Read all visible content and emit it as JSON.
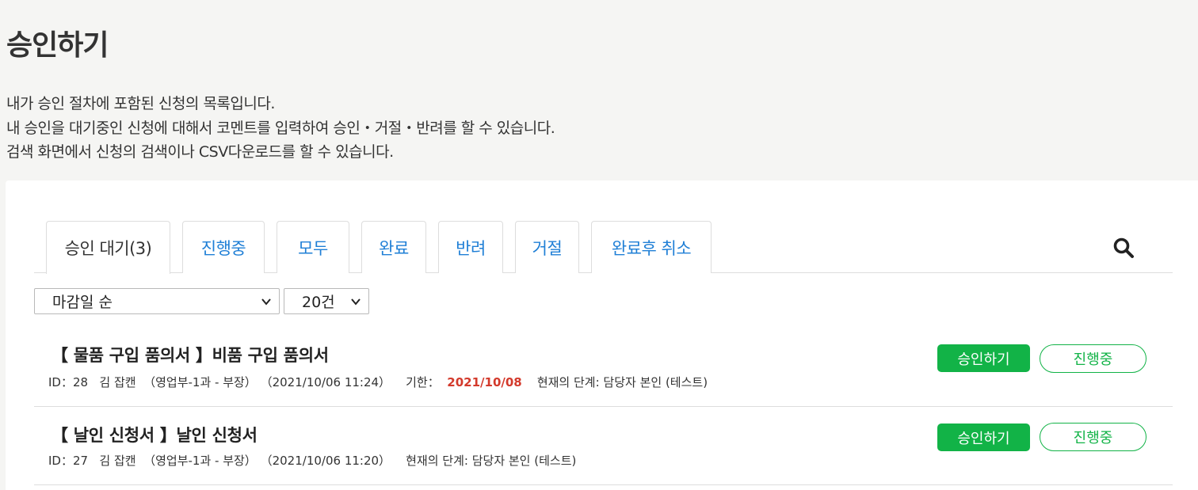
{
  "page": {
    "title": "승인하기",
    "description": [
      "내가 승인 절차에 포함된 신청의 목록입니다.",
      "내 승인을 대기중인 신청에 대해서 코멘트를 입력하여 승인・거절・반려를 할 수 있습니다.",
      "검색 화면에서 신청의 검색이나 CSV다운로드를 할 수 있습니다."
    ]
  },
  "tabs": [
    {
      "label": "승인 대기(3)",
      "active": true
    },
    {
      "label": "진행중",
      "active": false
    },
    {
      "label": "모두",
      "active": false
    },
    {
      "label": "완료",
      "active": false
    },
    {
      "label": "반려",
      "active": false
    },
    {
      "label": "거절",
      "active": false
    },
    {
      "label": "완료후 취소",
      "active": false
    }
  ],
  "icons": {
    "search": "search-icon",
    "dropdown": "chevron-down-icon"
  },
  "filters": {
    "sort": {
      "selected": "마감일 순"
    },
    "count": {
      "selected": "20건"
    }
  },
  "colors": {
    "accent_green": "#12b347",
    "tab_link": "#1f7fd6",
    "deadline_red": "#d33a2c"
  },
  "items": [
    {
      "title": "【 물품 구입 품의서 】비품 구입 품의서",
      "id": "ID：28",
      "applicant": "김 잡캔",
      "dept": "（영업부-1과 - 부장）",
      "datetime": "（2021/10/06 11:24）",
      "deadline_label": "기한：",
      "deadline": "2021/10/08",
      "stage": "현재의 단계: 담당자 본인 (테스트)",
      "approve_label": "승인하기",
      "status_label": "진행중"
    },
    {
      "title": "【 날인 신청서 】날인 신청서",
      "id": "ID：27",
      "applicant": "김 잡캔",
      "dept": "（영업부-1과 - 부장）",
      "datetime": "（2021/10/06 11:20）",
      "stage": "현재의 단계: 담당자 본인 (테스트)",
      "approve_label": "승인하기",
      "status_label": "진행중"
    }
  ]
}
